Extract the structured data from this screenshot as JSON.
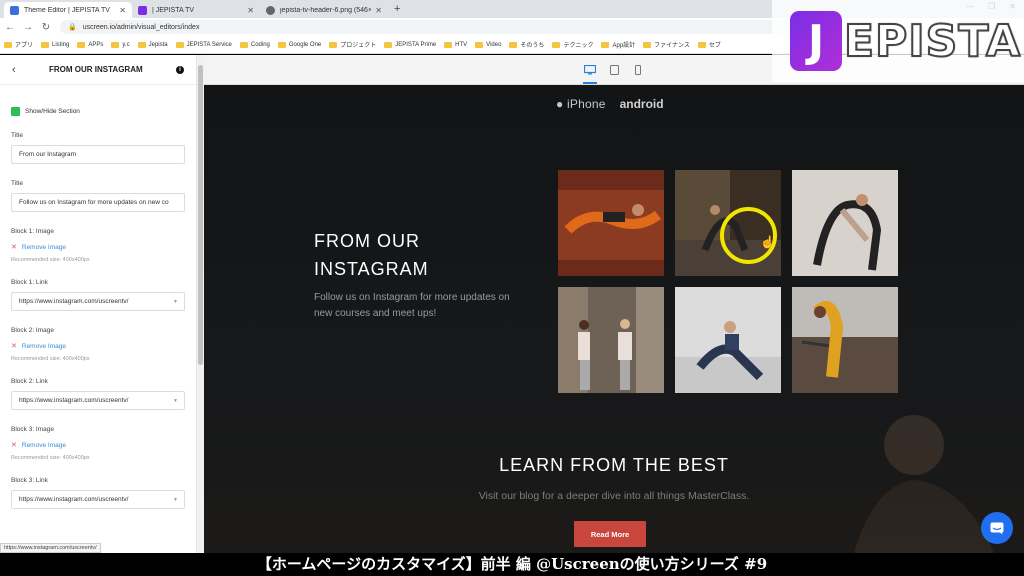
{
  "browser": {
    "tabs": [
      {
        "label": "Theme Editor | JEPISTA TV",
        "icon_color": "#3b6fd9",
        "active": true
      },
      {
        "label": "| JEPISTA TV",
        "icon_color": "#7a2ee6",
        "active": false
      },
      {
        "label": "jepista-tv-header-6.png (546×10",
        "icon_color": "#666666",
        "active": false
      }
    ],
    "new_tab": "+",
    "url": "uscreen.io/admin/visual_editors/index",
    "bookmarks": [
      "アプリ",
      "Listing",
      "APPs",
      "y.c",
      "Jepista",
      "JEPISTA Service",
      "Coding",
      "Google One",
      "プロジェクト",
      "JEPISTA Prime",
      "HTV",
      "Video",
      "そのうち",
      "テクニック",
      "App設計",
      "ファイナンス",
      "セブ"
    ],
    "status_url": "https://www.instagram.com/uscreentv/"
  },
  "sidebar": {
    "title": "FROM OUR INSTAGRAM",
    "show_hide_label": "Show/Hide Section",
    "fields": [
      {
        "label": "Title",
        "value": "From our Instagram"
      },
      {
        "label": "Title",
        "value": "Follow us on Instagram for more updates on new co"
      }
    ],
    "blocks": [
      {
        "image_label": "Block 1: Image",
        "remove_label": "Remove Image",
        "recommended": "Recommended size: 400x400px",
        "link_label": "Block 1: Link",
        "link_value": "https://www.instagram.com/uscreentv/"
      },
      {
        "image_label": "Block 2: Image",
        "remove_label": "Remove Image",
        "recommended": "Recommended size: 400x400px",
        "link_label": "Block 2: Link",
        "link_value": "https://www.instagram.com/uscreentv/"
      },
      {
        "image_label": "Block 3: Image",
        "remove_label": "Remove Image",
        "recommended": "Recommended size: 400x400px",
        "link_label": "Block 3: Link",
        "link_value": "https://www.instagram.com/uscreentv/"
      }
    ]
  },
  "preview": {
    "logo_iphone": "iPhone",
    "logo_android": "android",
    "instagram_title": "FROM OUR INSTAGRAM",
    "instagram_subtitle": "Follow us on Instagram for more updates on new courses and meet ups!",
    "learn_title": "LEARN FROM THE BEST",
    "learn_subtitle": "Visit our blog for a deeper dive into all things MasterClass.",
    "read_more": "Read More",
    "accent": "#c9463d"
  },
  "overlay": {
    "brand_first": "J",
    "brand_rest": "EPISTA"
  },
  "caption": "【ホームページのカスタマイズ】前半 編 @Uscreenの使い方シリーズ #9"
}
